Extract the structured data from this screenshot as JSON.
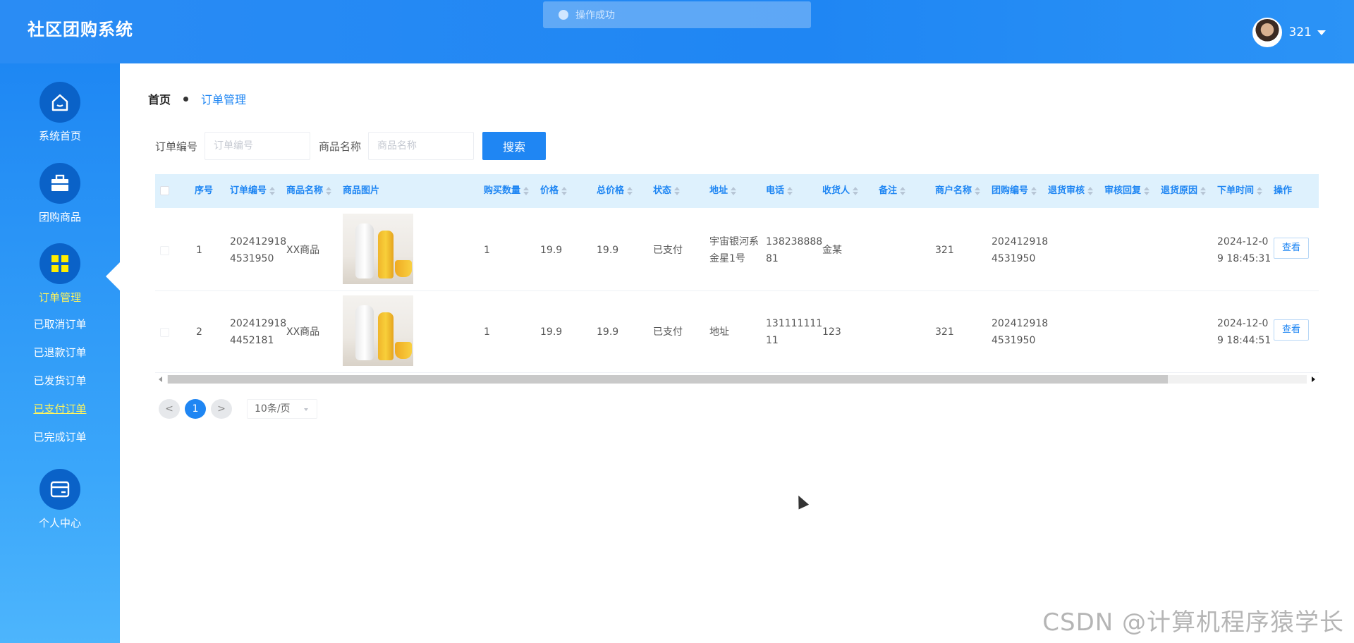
{
  "app": {
    "title": "社区团购系统"
  },
  "toast": {
    "text": "操作成功"
  },
  "user": {
    "name": "321"
  },
  "sidebar": {
    "items": [
      {
        "label": "系统首页",
        "icon": "home-icon"
      },
      {
        "label": "团购商品",
        "icon": "briefcase-icon"
      },
      {
        "label": "订单管理",
        "icon": "grid-icon",
        "active": true
      },
      {
        "label": "个人中心",
        "icon": "wallet-icon"
      }
    ],
    "sub_items": [
      {
        "label": "已取消订单"
      },
      {
        "label": "已退款订单"
      },
      {
        "label": "已发货订单"
      },
      {
        "label": "已支付订单",
        "current": true
      },
      {
        "label": "已完成订单"
      }
    ]
  },
  "breadcrumb": {
    "home": "首页",
    "current": "订单管理"
  },
  "search": {
    "order_no_label": "订单编号",
    "order_no_placeholder": "订单编号",
    "goods_name_label": "商品名称",
    "goods_name_placeholder": "商品名称",
    "button": "搜索"
  },
  "table": {
    "columns": [
      "序号",
      "订单编号",
      "商品名称",
      "商品图片",
      "购买数量",
      "价格",
      "总价格",
      "状态",
      "地址",
      "电话",
      "收货人",
      "备注",
      "商户名称",
      "团购编号",
      "退货审核",
      "审核回复",
      "退货原因",
      "下单时间",
      "操作"
    ],
    "rows": [
      {
        "index": "1",
        "order_no_1": "202412918",
        "order_no_2": "4531950",
        "goods_name": "XX商品",
        "qty": "1",
        "price": "19.9",
        "total": "19.9",
        "status": "已支付",
        "address_1": "宇宙银河系",
        "address_2": "金星1号",
        "phone_1": "138238888",
        "phone_2": "81",
        "receiver": "金某",
        "note": "",
        "merchant": "321",
        "group_no_1": "202412918",
        "group_no_2": "4531950",
        "return_audit": "",
        "audit_reply": "",
        "return_reason": "",
        "order_time_1": "2024-12-0",
        "order_time_2": "9 18:45:31",
        "action": "查看"
      },
      {
        "index": "2",
        "order_no_1": "202412918",
        "order_no_2": "4452181",
        "goods_name": "XX商品",
        "qty": "1",
        "price": "19.9",
        "total": "19.9",
        "status": "已支付",
        "address_1": "地址",
        "address_2": "",
        "phone_1": "131111111",
        "phone_2": "11",
        "receiver": "123",
        "note": "",
        "merchant": "321",
        "group_no_1": "202412918",
        "group_no_2": "4531950",
        "return_audit": "",
        "audit_reply": "",
        "return_reason": "",
        "order_time_1": "2024-12-0",
        "order_time_2": "9 18:44:51",
        "action": "查看"
      }
    ]
  },
  "pagination": {
    "prev": "<",
    "current_page": "1",
    "next": ">",
    "page_size": "10条/页"
  },
  "watermark": "CSDN @计算机程序猿学长",
  "colors": {
    "primary": "#1f86f3",
    "header_bg": "#2a8cf4",
    "table_header_bg": "#def1fd",
    "active_nav": "#fff45c"
  }
}
